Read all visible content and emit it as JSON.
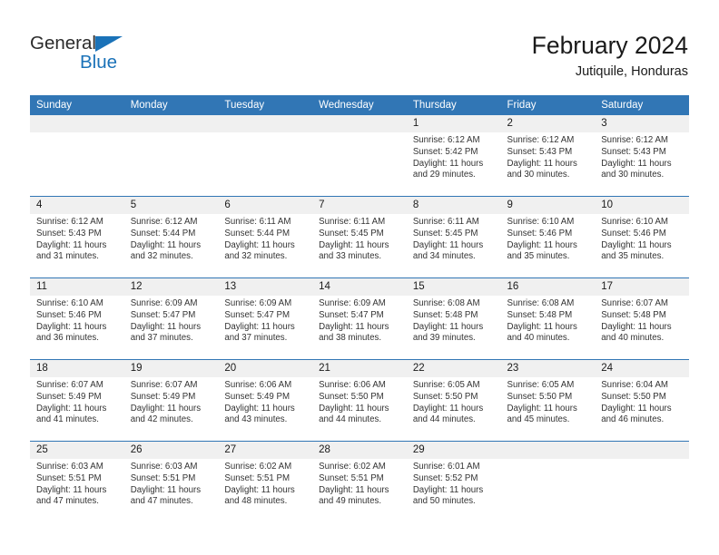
{
  "brand": {
    "name_top": "General",
    "name_bottom": "Blue",
    "triangle_color": "#1a72b8",
    "text_color": "#2b2b2b"
  },
  "header": {
    "title": "February 2024",
    "subtitle": "Jutiquile, Honduras",
    "accent_color": "#3176b5",
    "daynum_band_color": "#f0f0f0"
  },
  "calendar": {
    "weekday_headers": [
      "Sunday",
      "Monday",
      "Tuesday",
      "Wednesday",
      "Thursday",
      "Friday",
      "Saturday"
    ],
    "weeks": [
      [
        {
          "day": "",
          "empty": true
        },
        {
          "day": "",
          "empty": true
        },
        {
          "day": "",
          "empty": true
        },
        {
          "day": "",
          "empty": true
        },
        {
          "day": "1",
          "sunrise": "Sunrise: 6:12 AM",
          "sunset": "Sunset: 5:42 PM",
          "daylight": "Daylight: 11 hours and 29 minutes."
        },
        {
          "day": "2",
          "sunrise": "Sunrise: 6:12 AM",
          "sunset": "Sunset: 5:43 PM",
          "daylight": "Daylight: 11 hours and 30 minutes."
        },
        {
          "day": "3",
          "sunrise": "Sunrise: 6:12 AM",
          "sunset": "Sunset: 5:43 PM",
          "daylight": "Daylight: 11 hours and 30 minutes."
        }
      ],
      [
        {
          "day": "4",
          "sunrise": "Sunrise: 6:12 AM",
          "sunset": "Sunset: 5:43 PM",
          "daylight": "Daylight: 11 hours and 31 minutes."
        },
        {
          "day": "5",
          "sunrise": "Sunrise: 6:12 AM",
          "sunset": "Sunset: 5:44 PM",
          "daylight": "Daylight: 11 hours and 32 minutes."
        },
        {
          "day": "6",
          "sunrise": "Sunrise: 6:11 AM",
          "sunset": "Sunset: 5:44 PM",
          "daylight": "Daylight: 11 hours and 32 minutes."
        },
        {
          "day": "7",
          "sunrise": "Sunrise: 6:11 AM",
          "sunset": "Sunset: 5:45 PM",
          "daylight": "Daylight: 11 hours and 33 minutes."
        },
        {
          "day": "8",
          "sunrise": "Sunrise: 6:11 AM",
          "sunset": "Sunset: 5:45 PM",
          "daylight": "Daylight: 11 hours and 34 minutes."
        },
        {
          "day": "9",
          "sunrise": "Sunrise: 6:10 AM",
          "sunset": "Sunset: 5:46 PM",
          "daylight": "Daylight: 11 hours and 35 minutes."
        },
        {
          "day": "10",
          "sunrise": "Sunrise: 6:10 AM",
          "sunset": "Sunset: 5:46 PM",
          "daylight": "Daylight: 11 hours and 35 minutes."
        }
      ],
      [
        {
          "day": "11",
          "sunrise": "Sunrise: 6:10 AM",
          "sunset": "Sunset: 5:46 PM",
          "daylight": "Daylight: 11 hours and 36 minutes."
        },
        {
          "day": "12",
          "sunrise": "Sunrise: 6:09 AM",
          "sunset": "Sunset: 5:47 PM",
          "daylight": "Daylight: 11 hours and 37 minutes."
        },
        {
          "day": "13",
          "sunrise": "Sunrise: 6:09 AM",
          "sunset": "Sunset: 5:47 PM",
          "daylight": "Daylight: 11 hours and 37 minutes."
        },
        {
          "day": "14",
          "sunrise": "Sunrise: 6:09 AM",
          "sunset": "Sunset: 5:47 PM",
          "daylight": "Daylight: 11 hours and 38 minutes."
        },
        {
          "day": "15",
          "sunrise": "Sunrise: 6:08 AM",
          "sunset": "Sunset: 5:48 PM",
          "daylight": "Daylight: 11 hours and 39 minutes."
        },
        {
          "day": "16",
          "sunrise": "Sunrise: 6:08 AM",
          "sunset": "Sunset: 5:48 PM",
          "daylight": "Daylight: 11 hours and 40 minutes."
        },
        {
          "day": "17",
          "sunrise": "Sunrise: 6:07 AM",
          "sunset": "Sunset: 5:48 PM",
          "daylight": "Daylight: 11 hours and 40 minutes."
        }
      ],
      [
        {
          "day": "18",
          "sunrise": "Sunrise: 6:07 AM",
          "sunset": "Sunset: 5:49 PM",
          "daylight": "Daylight: 11 hours and 41 minutes."
        },
        {
          "day": "19",
          "sunrise": "Sunrise: 6:07 AM",
          "sunset": "Sunset: 5:49 PM",
          "daylight": "Daylight: 11 hours and 42 minutes."
        },
        {
          "day": "20",
          "sunrise": "Sunrise: 6:06 AM",
          "sunset": "Sunset: 5:49 PM",
          "daylight": "Daylight: 11 hours and 43 minutes."
        },
        {
          "day": "21",
          "sunrise": "Sunrise: 6:06 AM",
          "sunset": "Sunset: 5:50 PM",
          "daylight": "Daylight: 11 hours and 44 minutes."
        },
        {
          "day": "22",
          "sunrise": "Sunrise: 6:05 AM",
          "sunset": "Sunset: 5:50 PM",
          "daylight": "Daylight: 11 hours and 44 minutes."
        },
        {
          "day": "23",
          "sunrise": "Sunrise: 6:05 AM",
          "sunset": "Sunset: 5:50 PM",
          "daylight": "Daylight: 11 hours and 45 minutes."
        },
        {
          "day": "24",
          "sunrise": "Sunrise: 6:04 AM",
          "sunset": "Sunset: 5:50 PM",
          "daylight": "Daylight: 11 hours and 46 minutes."
        }
      ],
      [
        {
          "day": "25",
          "sunrise": "Sunrise: 6:03 AM",
          "sunset": "Sunset: 5:51 PM",
          "daylight": "Daylight: 11 hours and 47 minutes."
        },
        {
          "day": "26",
          "sunrise": "Sunrise: 6:03 AM",
          "sunset": "Sunset: 5:51 PM",
          "daylight": "Daylight: 11 hours and 47 minutes."
        },
        {
          "day": "27",
          "sunrise": "Sunrise: 6:02 AM",
          "sunset": "Sunset: 5:51 PM",
          "daylight": "Daylight: 11 hours and 48 minutes."
        },
        {
          "day": "28",
          "sunrise": "Sunrise: 6:02 AM",
          "sunset": "Sunset: 5:51 PM",
          "daylight": "Daylight: 11 hours and 49 minutes."
        },
        {
          "day": "29",
          "sunrise": "Sunrise: 6:01 AM",
          "sunset": "Sunset: 5:52 PM",
          "daylight": "Daylight: 11 hours and 50 minutes."
        },
        {
          "day": "",
          "empty": true
        },
        {
          "day": "",
          "empty": true
        }
      ]
    ]
  }
}
